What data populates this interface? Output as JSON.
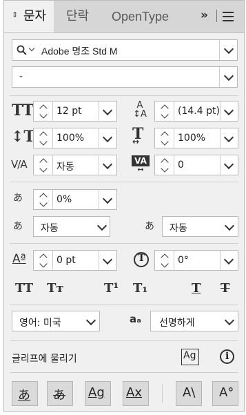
{
  "tabs": [
    {
      "label": "문자"
    },
    {
      "label": "단락"
    },
    {
      "label": "OpenType"
    }
  ],
  "font": {
    "family": "Adobe 명조 Std M",
    "style": "-"
  },
  "size": {
    "value": "12 pt"
  },
  "leading": {
    "value": "(14.4 pt)"
  },
  "vscale": {
    "value": "100%"
  },
  "hscale": {
    "value": "100%"
  },
  "kerning": {
    "value": "자동"
  },
  "tracking": {
    "value": "0"
  },
  "tsume": {
    "value": "0%"
  },
  "aki_left": {
    "value": "자동"
  },
  "aki_right": {
    "value": "자동"
  },
  "baseline": {
    "value": "0 pt"
  },
  "rotation": {
    "value": "0°"
  },
  "language": {
    "value": "영어: 미국"
  },
  "antialias": {
    "value": "선명하게"
  },
  "snap": {
    "label": "글리프에 물리기"
  },
  "icons": {
    "size": "TT",
    "leading": "A↕A",
    "vscale": "↕T",
    "hscale": "↔T",
    "kerning": "V/A",
    "tracking": "VA",
    "tsume": "あ",
    "aki_left": "あ",
    "aki_right": "あ",
    "baseline": "Aª",
    "rotation": "T",
    "allcaps": "TT",
    "smallcaps": "Tт",
    "super": "T¹",
    "sub": "T₁",
    "underline": "T",
    "strike": "T",
    "aa": "aₐ",
    "glyph": "Ag",
    "info": "i",
    "b1": "あ",
    "b2": "あ",
    "b3": "Ag",
    "b4": "Ax",
    "b5": "A\\",
    "b6": "A°"
  }
}
